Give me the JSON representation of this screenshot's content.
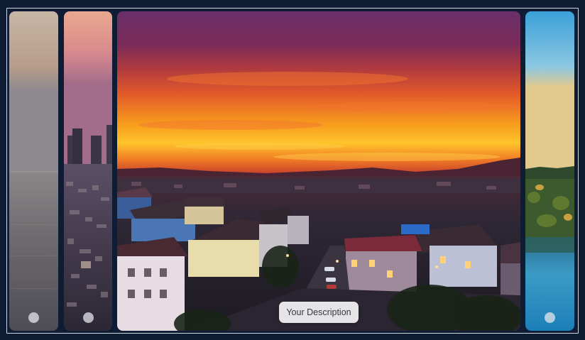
{
  "gallery": {
    "caption": "Your Description",
    "panels": [
      {
        "name": "sea-horizon",
        "active": false
      },
      {
        "name": "city-skyline",
        "active": false
      },
      {
        "name": "sunset-town",
        "active": true
      },
      {
        "name": "lake-forest",
        "active": false
      }
    ]
  },
  "colors": {
    "background": "#0e1d33",
    "frame_border": "#cfd6df",
    "caption_bg": "#f5f5f8",
    "caption_text": "#333a44"
  }
}
